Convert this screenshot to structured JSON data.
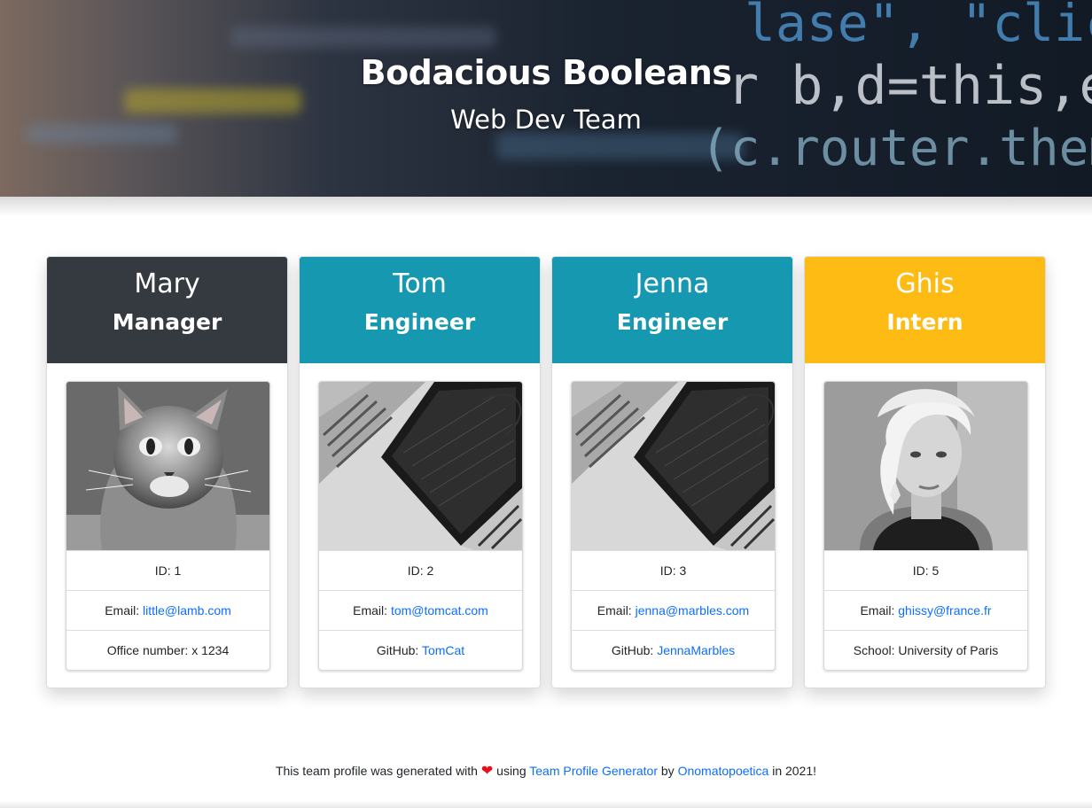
{
  "header": {
    "title": "Bodacious Booleans",
    "subtitle": "Web Dev Team",
    "background_code": [
      "lase\", \"click .coll",
      "r b,d=this,e=this",
      "(c.router.themeFa"
    ]
  },
  "colors": {
    "manager": "#343a40",
    "engineer": "#1798b1",
    "intern": "#fdbb13",
    "link": "#0d6efd"
  },
  "team": [
    {
      "name": "Mary",
      "role": "Manager",
      "photo": "cat-photo",
      "id_label": "ID: 1",
      "email_label": "Email: ",
      "email": "little@lamb.com",
      "extra_label": "Office number: x 1234",
      "extra_link": ""
    },
    {
      "name": "Tom",
      "role": "Engineer",
      "photo": "laptop-photo",
      "id_label": "ID: 2",
      "email_label": "Email: ",
      "email": "tom@tomcat.com",
      "extra_label": "GitHub: ",
      "extra_link": "TomCat"
    },
    {
      "name": "Jenna",
      "role": "Engineer",
      "photo": "laptop-photo",
      "id_label": "ID: 3",
      "email_label": "Email: ",
      "email": "jenna@marbles.com",
      "extra_label": "GitHub: ",
      "extra_link": "JennaMarbles"
    },
    {
      "name": "Ghis",
      "role": "Intern",
      "photo": "portrait-photo",
      "id_label": "ID: 5",
      "email_label": "Email: ",
      "email": "ghissy@france.fr",
      "extra_label": "School: University of Paris",
      "extra_link": ""
    }
  ],
  "footer": {
    "before_heart": "This team profile was generated with",
    "heart_icon": "heart-icon",
    "using": "using",
    "app_link": "Team Profile Generator",
    "by": "by",
    "author_link": "Onomatopoetica",
    "after": "in 2021!"
  }
}
